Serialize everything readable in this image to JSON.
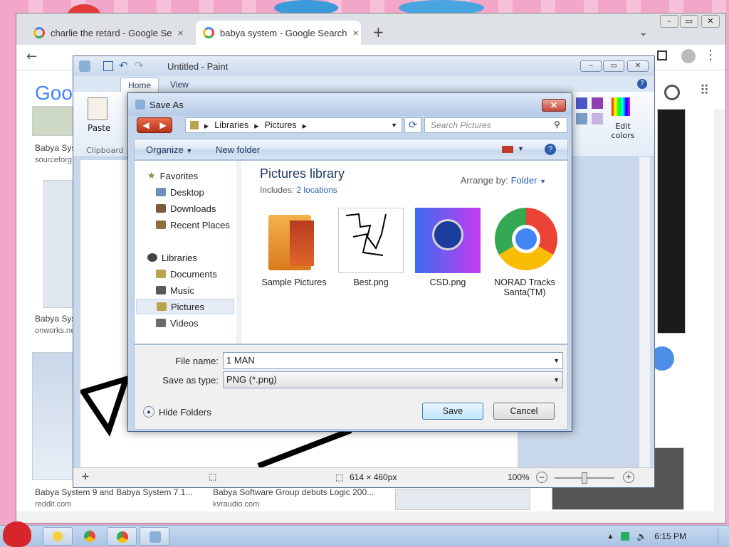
{
  "chrome": {
    "tabs": [
      {
        "title": "charlie the retard - Google Se",
        "close": "×"
      },
      {
        "title": "babya system - Google Search",
        "close": "×"
      }
    ],
    "new_tab": "+",
    "tab_menu": "⌄",
    "results": [
      {
        "title": "Babya Syst",
        "site": "sourceforg"
      },
      {
        "title": "Babya Sys",
        "site": "onworks.ne"
      },
      {
        "title": "Babya System 9 and Babya System 7.1...",
        "site": "reddit.com"
      },
      {
        "title": "Babya Software Group debuts Logic 200...",
        "site": "kvraudio.com"
      }
    ],
    "logo_partial": "Goo"
  },
  "paint": {
    "title": "Untitled - Paint",
    "tabs": [
      "Home",
      "View"
    ],
    "paste_label": "Paste",
    "clipboard_label": "Clipboard",
    "edit_colors": "Edit colors",
    "status": {
      "dimensions": "614 × 460px",
      "zoom": "100%"
    }
  },
  "dialog": {
    "title": "Save As",
    "close": "✕",
    "address": {
      "root": "Libraries",
      "current": "Pictures"
    },
    "search_placeholder": "Search Pictures",
    "organize": "Organize",
    "new_folder": "New folder",
    "nav": {
      "favorites": "Favorites",
      "favorites_items": [
        "Desktop",
        "Downloads",
        "Recent Places"
      ],
      "libraries": "Libraries",
      "library_items": [
        "Documents",
        "Music",
        "Pictures",
        "Videos"
      ],
      "selected": "Pictures"
    },
    "library_title": "Pictures library",
    "includes_label": "Includes:",
    "includes_link": "2 locations",
    "arrange_label": "Arrange by:",
    "arrange_value": "Folder",
    "files": [
      {
        "name": "Sample Pictures"
      },
      {
        "name": "Best.png"
      },
      {
        "name": "CSD.png"
      },
      {
        "name": "NORAD Tracks Santa(TM)"
      }
    ],
    "file_name_label": "File name:",
    "file_name_value": "1 MAN",
    "save_type_label": "Save as type:",
    "save_type_value": "PNG (*.png)",
    "hide_folders": "Hide Folders",
    "save_button": "Save",
    "cancel_button": "Cancel"
  },
  "taskbar": {
    "time": "6:15 PM"
  }
}
